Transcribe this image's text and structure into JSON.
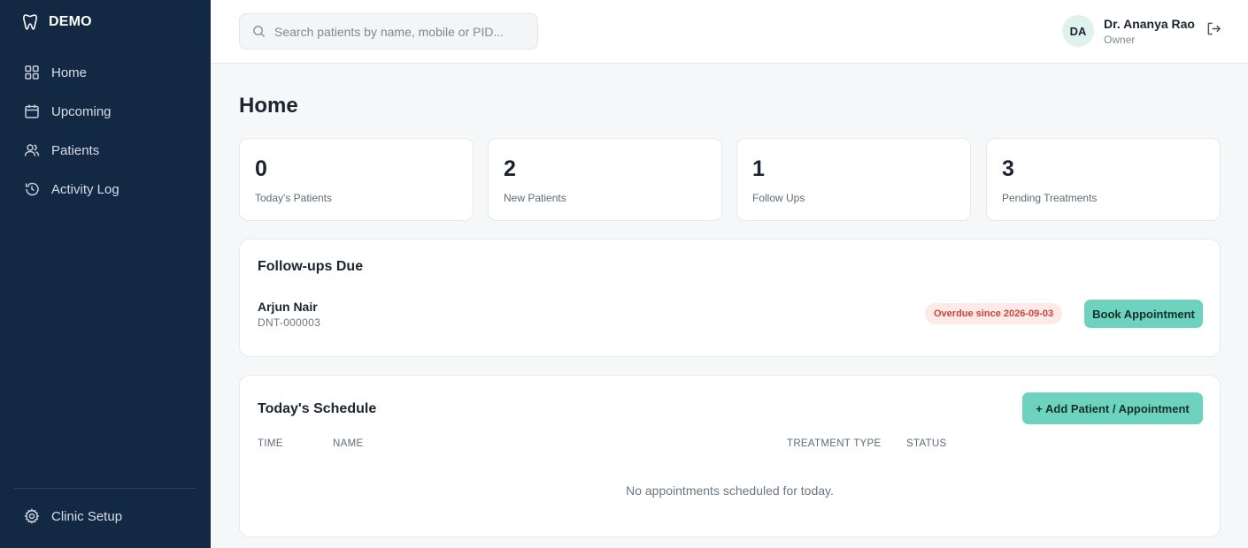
{
  "brand": {
    "name": "DEMO"
  },
  "sidebar": {
    "items": [
      {
        "label": "Home",
        "icon": "grid-icon"
      },
      {
        "label": "Upcoming",
        "icon": "calendar-icon"
      },
      {
        "label": "Patients",
        "icon": "users-icon"
      },
      {
        "label": "Activity Log",
        "icon": "history-icon"
      }
    ],
    "footer": {
      "label": "Clinic Setup",
      "icon": "gear-icon"
    }
  },
  "search": {
    "placeholder": "Search patients by name, mobile or PID..."
  },
  "user": {
    "initials": "DA",
    "name": "Dr. Ananya Rao",
    "role": "Owner"
  },
  "page": {
    "title": "Home"
  },
  "stats": [
    {
      "value": "0",
      "label": "Today's Patients"
    },
    {
      "value": "2",
      "label": "New Patients"
    },
    {
      "value": "1",
      "label": "Follow Ups"
    },
    {
      "value": "3",
      "label": "Pending Treatments"
    }
  ],
  "followups": {
    "title": "Follow-ups Due",
    "item": {
      "name": "Arjun Nair",
      "pid": "DNT-000003",
      "badge": "Overdue since 2026-09-03",
      "action": "Book Appointment"
    }
  },
  "schedule": {
    "title": "Today's Schedule",
    "add_button": "+ Add Patient / Appointment",
    "columns": [
      "TIME",
      "NAME",
      "TREATMENT TYPE",
      "STATUS"
    ],
    "empty_text": "No appointments scheduled for today."
  },
  "colors": {
    "sidebar": "#132843",
    "accent": "#6dd3bf",
    "overdue": "#c9453b"
  }
}
